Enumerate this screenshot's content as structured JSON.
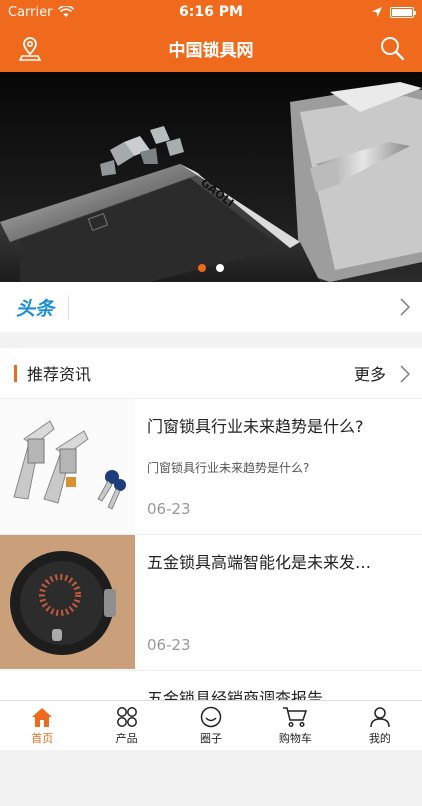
{
  "status": {
    "carrier": "Carrier",
    "time": "6:16 PM"
  },
  "navbar": {
    "title": "中国锁具网",
    "left_icon": "location-icon",
    "right_icon": "search-icon"
  },
  "banner": {
    "page_count": 2,
    "active_index": 0,
    "brand_text": "GAOLI"
  },
  "headline": {
    "tag": "头条"
  },
  "recommend": {
    "title": "推荐资讯",
    "more": "更多",
    "items": [
      {
        "title": "门窗锁具行业未来趋势是什么?",
        "desc": "门窗锁具行业未来趋势是什么?",
        "date": "06-23"
      },
      {
        "title": "五金锁具高端智能化是未来发…",
        "desc": "",
        "date": "06-23"
      },
      {
        "title": "五金锁具经销商调查报告",
        "desc": "",
        "date": ""
      }
    ]
  },
  "tabbar": {
    "active": "home",
    "items": [
      {
        "label": "首页",
        "icon": "home-icon"
      },
      {
        "label": "产品",
        "icon": "grid-icon"
      },
      {
        "label": "圈子",
        "icon": "circle-smile-icon"
      },
      {
        "label": "购物车",
        "icon": "cart-icon"
      },
      {
        "label": "我的",
        "icon": "user-icon"
      }
    ]
  },
  "colors": {
    "accent": "#f06a1e",
    "headline_blue": "#1b8fd6"
  }
}
